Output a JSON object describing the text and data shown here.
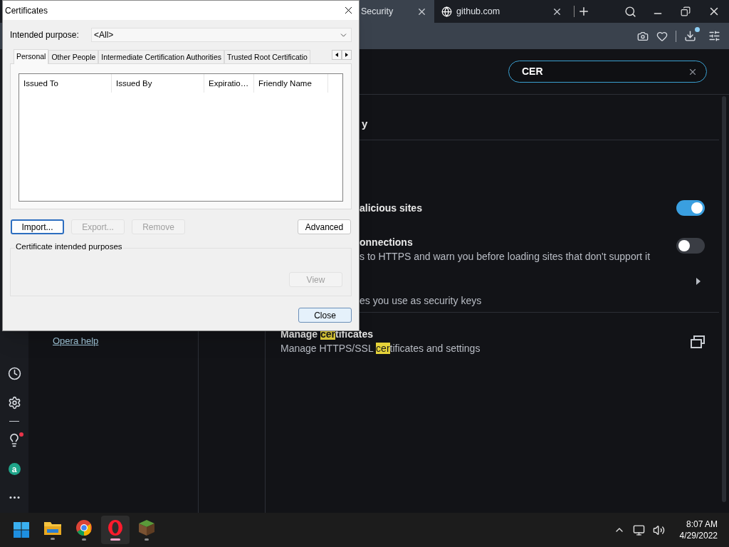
{
  "browser": {
    "tabs": [
      {
        "label": "Security",
        "selected": true,
        "kind": "page"
      },
      {
        "label": "github.com",
        "selected": false,
        "kind": "web"
      }
    ],
    "search": {
      "value": "CER"
    },
    "sidebar": {
      "app_badge": "a",
      "tips_unread": true
    },
    "nav": {
      "help_link": "Opera help"
    },
    "heading": "y",
    "rows": [
      {
        "kind": "toggle",
        "title": "alicious sites",
        "on": true
      },
      {
        "kind": "toggle",
        "title": "onnections",
        "description": "s to HTTPS and warn you before loading sites that don't support it",
        "on": false
      },
      {
        "kind": "link",
        "description": "es you use as security keys"
      },
      {
        "kind": "external",
        "title": {
          "before": "Manage ",
          "match": "cer",
          "after": "tificates"
        },
        "description": {
          "before": "Manage HTTPS/SSL ",
          "match": "cer",
          "after": "tificates and settings"
        }
      }
    ]
  },
  "dialog": {
    "title": "Certificates",
    "purpose_label": "Intended purpose:",
    "purpose_value": "<All>",
    "tabs": [
      {
        "label": "Personal",
        "selected": true
      },
      {
        "label": "Other People",
        "selected": false
      },
      {
        "label": "Intermediate Certification Authorities",
        "selected": false
      },
      {
        "label": "Trusted Root Certificatio",
        "selected": false
      }
    ],
    "columns": [
      "Issued To",
      "Issued By",
      "Expiratio…",
      "Friendly Name"
    ],
    "buttons": [
      {
        "label": "Import...",
        "disabled": false,
        "focused": true
      },
      {
        "label": "Export...",
        "disabled": true,
        "focused": false
      },
      {
        "label": "Remove",
        "disabled": true,
        "focused": false
      }
    ],
    "advanced": "Advanced",
    "group_title": "Certificate intended purposes",
    "view": {
      "label": "View",
      "disabled": true
    },
    "close": "Close"
  },
  "taskbar": {
    "apps": [
      {
        "kind": "start",
        "selected": false
      },
      {
        "kind": "files",
        "selected": false
      },
      {
        "kind": "chrome",
        "selected": false
      },
      {
        "kind": "opera",
        "selected": true
      },
      {
        "kind": "block",
        "selected": false
      }
    ],
    "time": "8:07 AM",
    "date": "4/29/2022"
  }
}
